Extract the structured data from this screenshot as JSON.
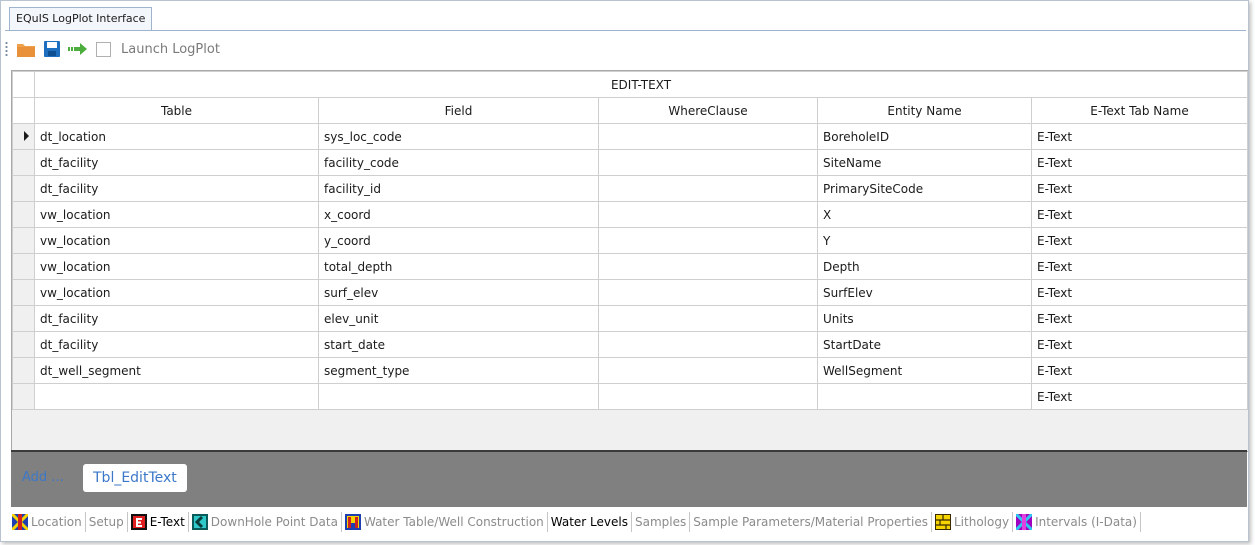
{
  "window": {
    "tab_title": "EQuIS LogPlot Interface"
  },
  "toolbar": {
    "icons": [
      "folder-icon",
      "save-icon",
      "arrow-right-icon"
    ],
    "launch_label": "Launch LogPlot"
  },
  "grid": {
    "caption": "EDIT-TEXT",
    "columns": [
      "Table",
      "Field",
      "WhereClause",
      "Entity Name",
      "E-Text Tab Name"
    ],
    "rows": [
      [
        "dt_location",
        "sys_loc_code",
        "",
        "BoreholeID",
        "E-Text"
      ],
      [
        "dt_facility",
        "facility_code",
        "",
        "SiteName",
        "E-Text"
      ],
      [
        "dt_facility",
        "facility_id",
        "",
        "PrimarySiteCode",
        "E-Text"
      ],
      [
        "vw_location",
        "x_coord",
        "",
        "X",
        "E-Text"
      ],
      [
        "vw_location",
        "y_coord",
        "",
        "Y",
        "E-Text"
      ],
      [
        "vw_location",
        "total_depth",
        "",
        "Depth",
        "E-Text"
      ],
      [
        "vw_location",
        "surf_elev",
        "",
        "SurfElev",
        "E-Text"
      ],
      [
        "dt_facility",
        "elev_unit",
        "",
        "Units",
        "E-Text"
      ],
      [
        "dt_facility",
        "start_date",
        "",
        "StartDate",
        "E-Text"
      ],
      [
        "dt_well_segment",
        "segment_type",
        "",
        "WellSegment",
        "E-Text"
      ],
      [
        "",
        "",
        "",
        "",
        "E-Text"
      ]
    ]
  },
  "panel": {
    "add_label": "Add ...",
    "table_button": "Tbl_EditText"
  },
  "tabs": [
    {
      "label": "Location",
      "icon": "location-icon",
      "active": false
    },
    {
      "label": "Setup",
      "icon": "",
      "active": false
    },
    {
      "label": "E-Text",
      "icon": "etext-icon",
      "active": true
    },
    {
      "label": "DownHole Point Data",
      "icon": "downhole-icon",
      "active": false
    },
    {
      "label": "Water Table/Well Construction",
      "icon": "well-icon",
      "active": false
    },
    {
      "label": "Water Levels",
      "icon": "",
      "active": true
    },
    {
      "label": "Samples",
      "icon": "",
      "active": false
    },
    {
      "label": "Sample Parameters/Material Properties",
      "icon": "",
      "active": false
    },
    {
      "label": "Lithology",
      "icon": "lithology-icon",
      "active": false
    },
    {
      "label": "Intervals (I-Data)",
      "icon": "intervals-icon",
      "active": false
    }
  ]
}
